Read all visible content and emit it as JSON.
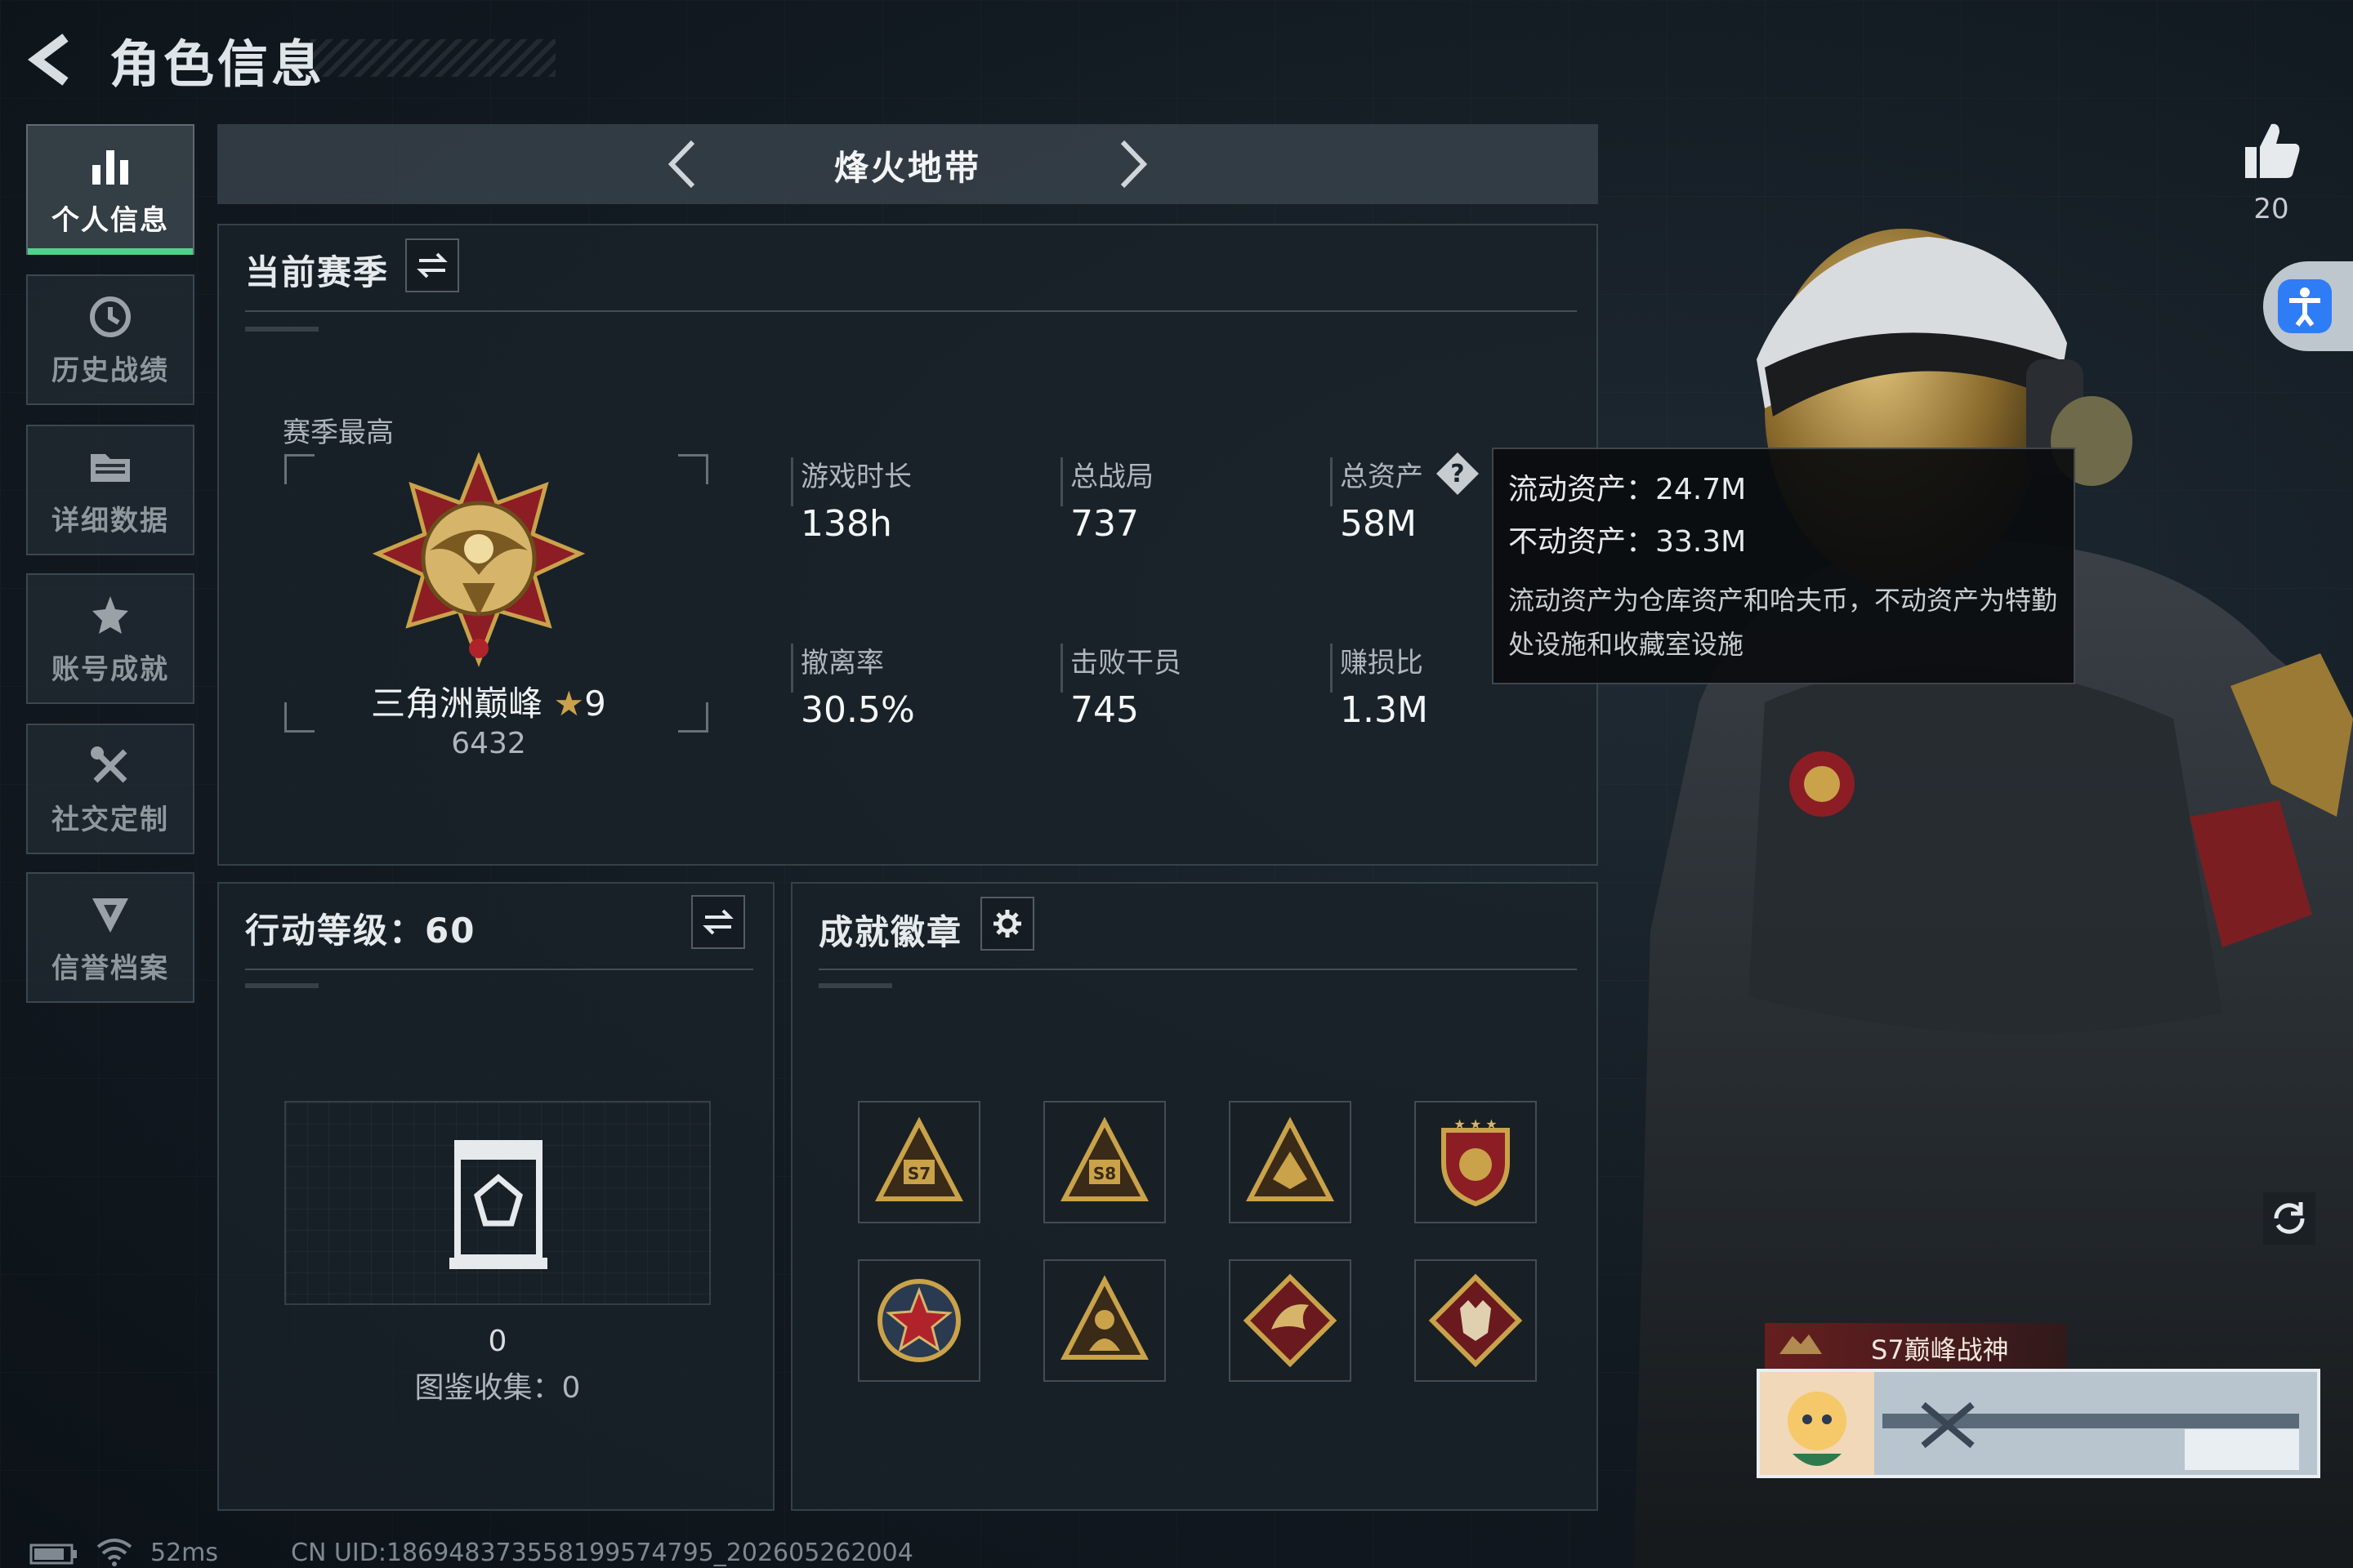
{
  "header": {
    "title": "角色信息"
  },
  "sidebar": {
    "items": [
      {
        "label": "个人信息",
        "icon": "bar-chart-icon",
        "active": true
      },
      {
        "label": "历史战绩",
        "icon": "history-clock-icon",
        "active": false
      },
      {
        "label": "详细数据",
        "icon": "folder-data-icon",
        "active": false
      },
      {
        "label": "账号成就",
        "icon": "achievement-star-icon",
        "active": false
      },
      {
        "label": "社交定制",
        "icon": "wrench-tools-icon",
        "active": false
      },
      {
        "label": "信誉档案",
        "icon": "shield-credit-icon",
        "active": false
      }
    ]
  },
  "mode": {
    "title": "烽火地带"
  },
  "season": {
    "title": "当前赛季",
    "best_label": "赛季最高",
    "rank_name": "三角洲巅峰",
    "rank_stars": "9",
    "rank_score": "6432",
    "stats": [
      {
        "label": "游戏时长",
        "value": "138h"
      },
      {
        "label": "总战局",
        "value": "737"
      },
      {
        "label": "总资产",
        "value": "58M"
      },
      {
        "label": "撤离率",
        "value": "30.5%"
      },
      {
        "label": "击败干员",
        "value": "745"
      },
      {
        "label": "赚损比",
        "value": "1.3M"
      }
    ]
  },
  "tooltip": {
    "liquid": "流动资产：24.7M",
    "fixed": "不动资产：33.3M",
    "desc": "流动资产为仓库资产和哈夫币，不动资产为特勤处设施和收藏室设施"
  },
  "action_level": {
    "title": "行动等级：60",
    "count": "0",
    "collection": "图鉴收集：0"
  },
  "achievements": {
    "title": "成就徽章",
    "badges": [
      "s7-triangle-badge",
      "s8-triangle-badge",
      "triangle-emblem-badge",
      "shield-stars-badge",
      "star-seal-badge",
      "soldier-triangle-badge",
      "dragon-diamond-badge",
      "wolf-diamond-badge"
    ]
  },
  "right": {
    "likes": "20",
    "title_badge": "S7巅峰战神"
  },
  "footer": {
    "ping": "52ms",
    "uid": "CN UID:18694837355819957479​5_202605262004"
  },
  "colors": {
    "accent_green": "#4fd18b",
    "accessibility_blue": "#2f7df6",
    "gold": "#c9a24a"
  }
}
